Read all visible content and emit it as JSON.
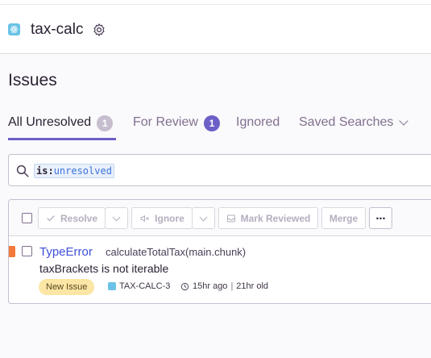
{
  "project": {
    "name": "tax-calc",
    "settings_icon": "gear-icon",
    "platform_icon": "react-icon"
  },
  "page": {
    "title": "Issues"
  },
  "tabs": [
    {
      "label": "All Unresolved",
      "count": "1",
      "active": true,
      "badge_color": "#c6becf"
    },
    {
      "label": "For Review",
      "count": "1",
      "active": false,
      "badge_color": "#6c5fc7"
    },
    {
      "label": "Ignored",
      "active": false
    },
    {
      "label": "Saved Searches",
      "active": false,
      "icon": "chevron-down-icon"
    }
  ],
  "search": {
    "key": "is:",
    "value": "unresolved",
    "icon": "search-icon"
  },
  "actions": {
    "resolve": "Resolve",
    "ignore": "Ignore",
    "mark_reviewed": "Mark Reviewed",
    "merge": "Merge",
    "more": "⋯"
  },
  "issues": [
    {
      "type": "TypeError",
      "culprit": "calculateTotalTax(main.chunk)",
      "message": "taxBrackets is not iterable",
      "tag": "New Issue",
      "short_id": "TAX-CALC-3",
      "last_seen": "15hr ago",
      "age": "21hr old",
      "level_color": "#f2793a"
    }
  ],
  "colors": {
    "accent": "#6c5fc7",
    "link": "#3d4fdb",
    "border": "#c6becf"
  }
}
